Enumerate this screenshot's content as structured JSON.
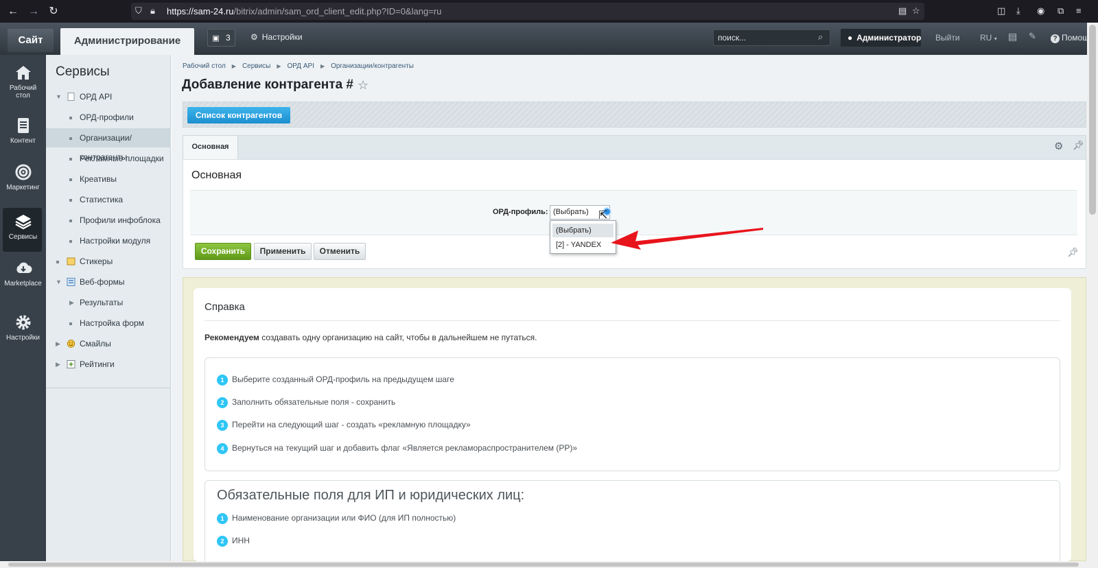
{
  "browser": {
    "url_host": "https://sam-24.ru",
    "url_path": "/bitrix/admin/sam_ord_client_edit.php?ID=0&lang=ru"
  },
  "topbar": {
    "site_tab": "Сайт",
    "admin_tab": "Администрирование",
    "notifications_count": "3",
    "settings_label": "Настройки",
    "search_placeholder": "поиск...",
    "user_label": "Администратор",
    "logout_label": "Выйти",
    "lang_label": "RU",
    "help_label": "Помощь"
  },
  "rail": {
    "items": [
      {
        "label": "Рабочий стол",
        "icon": "home-icon"
      },
      {
        "label": "Контент",
        "icon": "document-icon"
      },
      {
        "label": "Маркетинг",
        "icon": "target-icon"
      },
      {
        "label": "Сервисы",
        "icon": "layers-icon"
      },
      {
        "label": "Marketplace",
        "icon": "cloud-download-icon"
      },
      {
        "label": "Настройки",
        "icon": "gear-icon"
      }
    ],
    "active": "Сервисы"
  },
  "sidebar": {
    "title": "Сервисы",
    "items": [
      {
        "label": "ОРД API"
      },
      {
        "label": "ОРД-профили"
      },
      {
        "label": "Организации/контрагенты"
      },
      {
        "label": "Рекламные площадки"
      },
      {
        "label": "Креативы"
      },
      {
        "label": "Статистика"
      },
      {
        "label": "Профили инфоблока"
      },
      {
        "label": "Настройки модуля"
      },
      {
        "label": "Стикеры"
      },
      {
        "label": "Веб-формы"
      },
      {
        "label": "Результаты"
      },
      {
        "label": "Настройка форм"
      },
      {
        "label": "Смайлы"
      },
      {
        "label": "Рейтинги"
      }
    ],
    "active": "Организации/контрагенты"
  },
  "breadcrumbs": [
    "Рабочий стол",
    "Сервисы",
    "ОРД API",
    "Организации/контрагенты"
  ],
  "page": {
    "title": "Добавление контрагента #",
    "list_button": "Список контрагентов",
    "tab_label": "Основная",
    "section_title": "Основная",
    "field_label": "ОРД-профиль",
    "select_value": "(Выбрать)",
    "options": [
      "(Выбрать)",
      "[2] - YANDEX"
    ],
    "save_button": "Сохранить",
    "apply_button": "Применить",
    "cancel_button": "Отменить"
  },
  "help": {
    "title": "Справка",
    "rec_bold": "Рекомендуем",
    "rec_rest": " создавать одну организацию на сайт, чтобы в дальнейшем не путаться.",
    "steps": [
      {
        "num": "1",
        "text": "Выберите созданный ОРД-профиль на предыдущем шаге"
      },
      {
        "num": "2",
        "text": "Заполнить обязательные поля - сохранить"
      },
      {
        "num": "3",
        "text": "Перейти на следующий шаг - создать «рекламную площадку»"
      },
      {
        "num": "4",
        "text": "Вернуться на текущий шаг и добавить флаг «Является рекламораспространителем (РР)»"
      }
    ],
    "required_title": "Обязательные поля для ИП и юридических лиц:",
    "required": [
      {
        "num": "1",
        "text": "Наименование организации или ФИО (для ИП полностью)"
      },
      {
        "num": "2",
        "text": "ИНН"
      }
    ]
  },
  "colors": {
    "accent_blue": "#1c8fd0",
    "save_green": "#6fab1f",
    "arrow_red": "#e8141c",
    "step_badge": "#2fc6f6"
  }
}
